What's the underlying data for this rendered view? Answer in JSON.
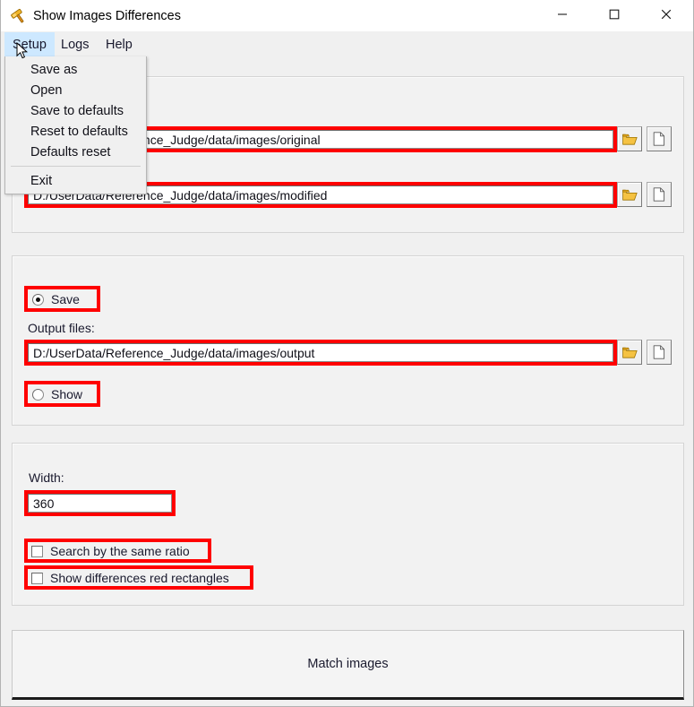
{
  "window": {
    "title": "Show Images Differences",
    "icon": "gavel-icon",
    "controls": {
      "minimize": "minimize-icon",
      "maximize": "maximize-icon",
      "close": "close-icon"
    }
  },
  "menubar": {
    "items": [
      {
        "label": "Setup",
        "active": true
      },
      {
        "label": "Logs",
        "active": false
      },
      {
        "label": "Help",
        "active": false
      }
    ]
  },
  "dropdown": {
    "open_menu": "Setup",
    "items": [
      "Save as",
      "Open",
      "Save to defaults",
      "Reset to defaults",
      "Defaults reset"
    ],
    "exit": "Exit"
  },
  "inputs_group": {
    "original": {
      "value": "D:/UserData/Reference_Judge/data/images/original",
      "browse_folder": "open-folder-icon",
      "browse_file": "file-page-icon"
    },
    "modified": {
      "value": "D:/UserData/Reference_Judge/data/images/modified",
      "browse_folder": "open-folder-icon",
      "browse_file": "file-page-icon"
    }
  },
  "output_group": {
    "save_radio": {
      "label": "Save",
      "selected": true
    },
    "output_label": "Output files:",
    "output_path": "D:/UserData/Reference_Judge/data/images/output",
    "browse_folder": "open-folder-icon",
    "browse_file": "file-page-icon",
    "show_radio": {
      "label": "Show",
      "selected": false
    }
  },
  "options_group": {
    "width_label": "Width:",
    "width_value": "360",
    "checkbox_ratio": {
      "label": "Search by the same ratio",
      "checked": false
    },
    "checkbox_rects": {
      "label": "Show differences red rectangles",
      "checked": false
    }
  },
  "action": {
    "match_label": "Match images"
  },
  "colors": {
    "highlight": "#ff0000",
    "menu_active_bg": "#cde8ff",
    "window_bg": "#f0f0f0",
    "group_bg": "#f2f2f2",
    "folder_icon": "#f5c242"
  }
}
